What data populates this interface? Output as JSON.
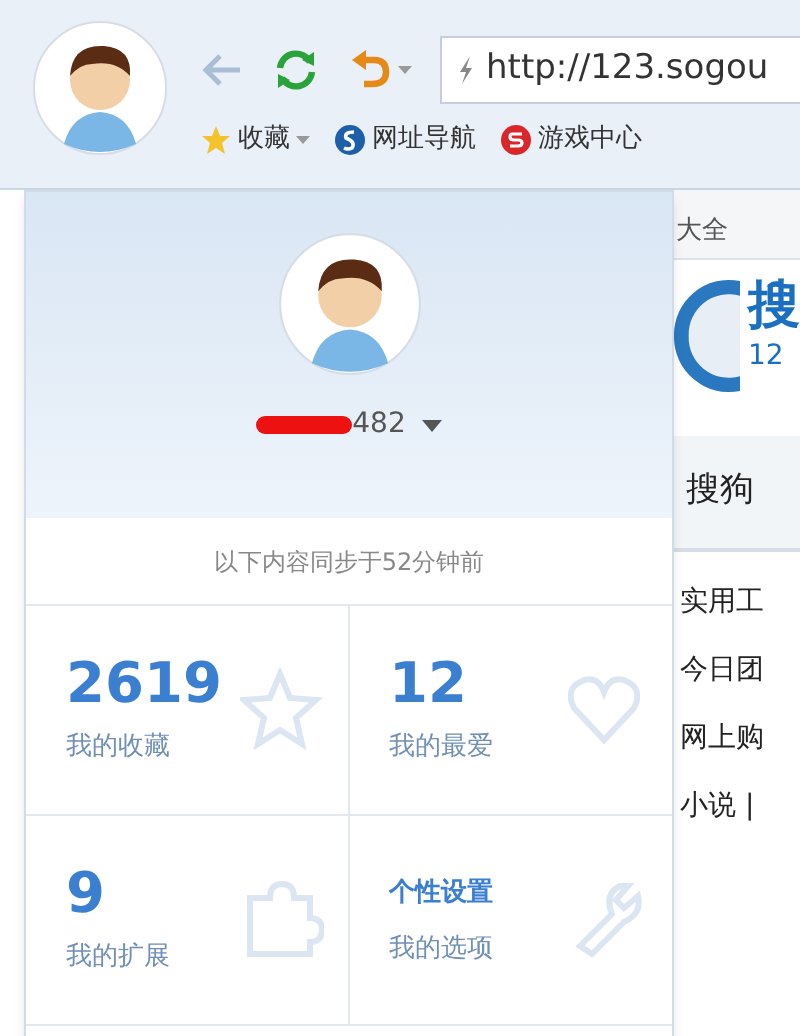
{
  "toolbar": {
    "address": "http://123.sogou",
    "bookmarks": [
      {
        "kind": "star",
        "label": "收藏",
        "menu": true
      },
      {
        "kind": "sogou",
        "label": "网址导航",
        "menu": false
      },
      {
        "kind": "game",
        "label": "游戏中心",
        "menu": false
      }
    ]
  },
  "page": {
    "tab_label": "大全",
    "logo_text": "搜",
    "logo_sub": "12",
    "section_title": "搜狗",
    "links": [
      "实用工",
      "今日团",
      "网上购",
      "小说 |"
    ]
  },
  "popup": {
    "username": "482",
    "redacted": true,
    "sync_note": "以下内容同步于52分钟前",
    "tiles": [
      {
        "kind": "star",
        "value": "2619",
        "label": "我的收藏"
      },
      {
        "kind": "heart",
        "value": "12",
        "label": "我的最爱"
      },
      {
        "kind": "puzzle",
        "value": "9",
        "label": "我的扩展"
      },
      {
        "kind": "wrench",
        "title": "个性设置",
        "label": "我的选项"
      }
    ]
  }
}
